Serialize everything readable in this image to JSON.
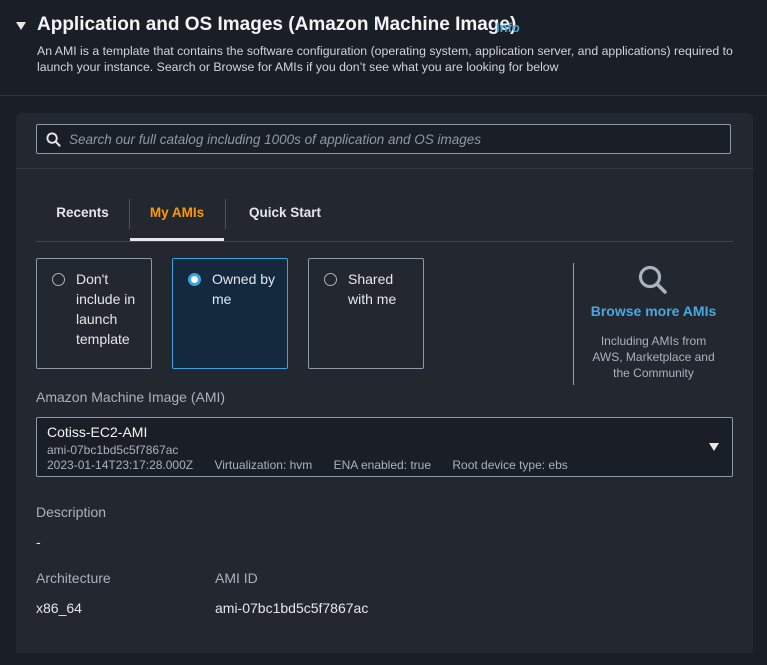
{
  "section": {
    "title": "Application and OS Images (Amazon Machine Image)",
    "info_label": "Info",
    "description": "An AMI is a template that contains the software configuration (operating system, application server, and applications) required to launch your instance. Search or Browse for AMIs if you don’t see what you are looking for below"
  },
  "search": {
    "placeholder": "Search our full catalog including 1000s of application and OS images",
    "value": ""
  },
  "tabs": [
    {
      "label": "Recents",
      "active": false
    },
    {
      "label": "My AMIs",
      "active": true
    },
    {
      "label": "Quick Start",
      "active": false
    }
  ],
  "ownership_options": [
    {
      "label": "Don't include in launch template",
      "selected": false
    },
    {
      "label": "Owned by me",
      "selected": true
    },
    {
      "label": "Shared with me",
      "selected": false
    }
  ],
  "browse": {
    "icon": "search-icon",
    "link_label": "Browse more AMIs",
    "subtext": "Including AMIs from AWS, Marketplace and the Community"
  },
  "ami": {
    "label": "Amazon Machine Image (AMI)",
    "name": "Cotiss-EC2-AMI",
    "id": "ami-07bc1bd5c5f7867ac",
    "created": "2023-01-14T23:17:28.000Z",
    "virtualization": "Virtualization: hvm",
    "ena": "ENA enabled: true",
    "root_device": "Root device type: ebs"
  },
  "details": {
    "description_label": "Description",
    "description_value": "-",
    "architecture_label": "Architecture",
    "architecture_value": "x86_64",
    "ami_id_label": "AMI ID",
    "ami_id_value": "ami-07bc1bd5c5f7867ac"
  },
  "colors": {
    "accent_orange": "#ff9900",
    "link_blue": "#49a8e0",
    "selected_blue": "#3ba3df",
    "background": "#1a1e26",
    "panel": "#232730"
  }
}
